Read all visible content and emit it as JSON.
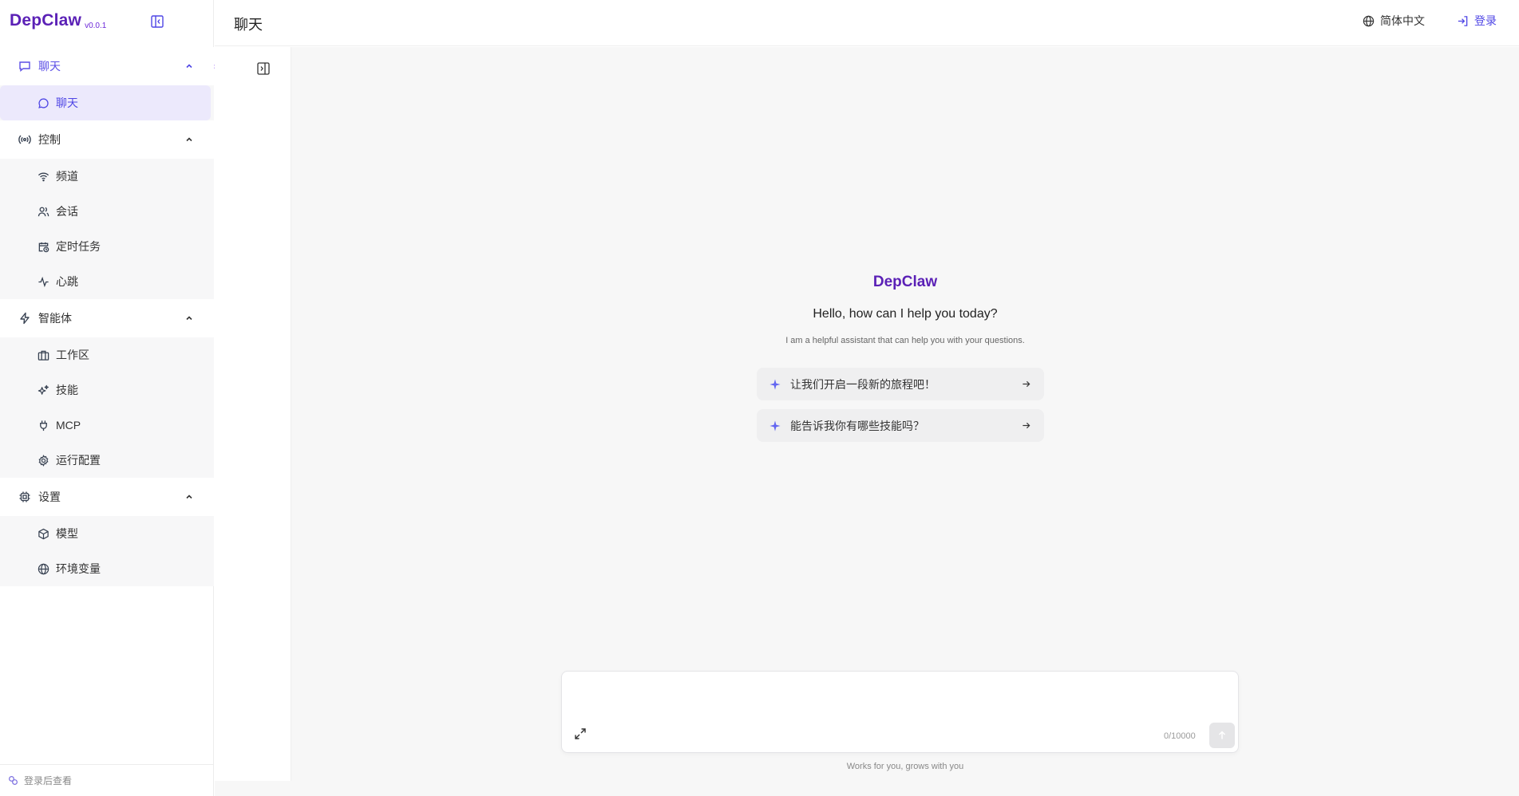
{
  "brand": {
    "name": "DepClaw",
    "version": "v0.0.1"
  },
  "colors": {
    "accent": "#4f46e5",
    "brand": "#5b21b6",
    "selected_bg": "#ece9fc",
    "spark": "#6366f1"
  },
  "sidebar": {
    "groups": [
      {
        "label": "聊天",
        "icon": "message-square-icon",
        "items": [
          {
            "label": "聊天",
            "icon": "message-circle-icon",
            "selected": true
          }
        ]
      },
      {
        "label": "控制",
        "icon": "broadcast-icon",
        "items": [
          {
            "label": "频道",
            "icon": "wifi-icon"
          },
          {
            "label": "会话",
            "icon": "users-icon"
          },
          {
            "label": "定时任务",
            "icon": "calendar-clock-icon"
          },
          {
            "label": "心跳",
            "icon": "activity-icon"
          }
        ]
      },
      {
        "label": "智能体",
        "icon": "zap-icon",
        "items": [
          {
            "label": "工作区",
            "icon": "briefcase-icon"
          },
          {
            "label": "技能",
            "icon": "sparkles-icon"
          },
          {
            "label": "MCP",
            "icon": "plug-icon"
          },
          {
            "label": "运行配置",
            "icon": "gear-icon"
          }
        ]
      },
      {
        "label": "设置",
        "icon": "cpu-icon",
        "items": [
          {
            "label": "模型",
            "icon": "box-icon"
          },
          {
            "label": "环境变量",
            "icon": "globe-icon"
          }
        ]
      }
    ],
    "footer": "登录后查看"
  },
  "header": {
    "title": "聊天",
    "language": "简体中文",
    "login": "登录"
  },
  "welcome": {
    "title": "DepClaw",
    "hello": "Hello, how can I help you today?",
    "subtitle": "I am a helpful assistant that can help you with your questions.",
    "prompts": [
      "让我们开启一段新的旅程吧！",
      "能告诉我你有哪些技能吗？"
    ]
  },
  "composer": {
    "value": "",
    "placeholder": "",
    "counter": "0/10000"
  },
  "tagline": "Works for you, grows with you"
}
